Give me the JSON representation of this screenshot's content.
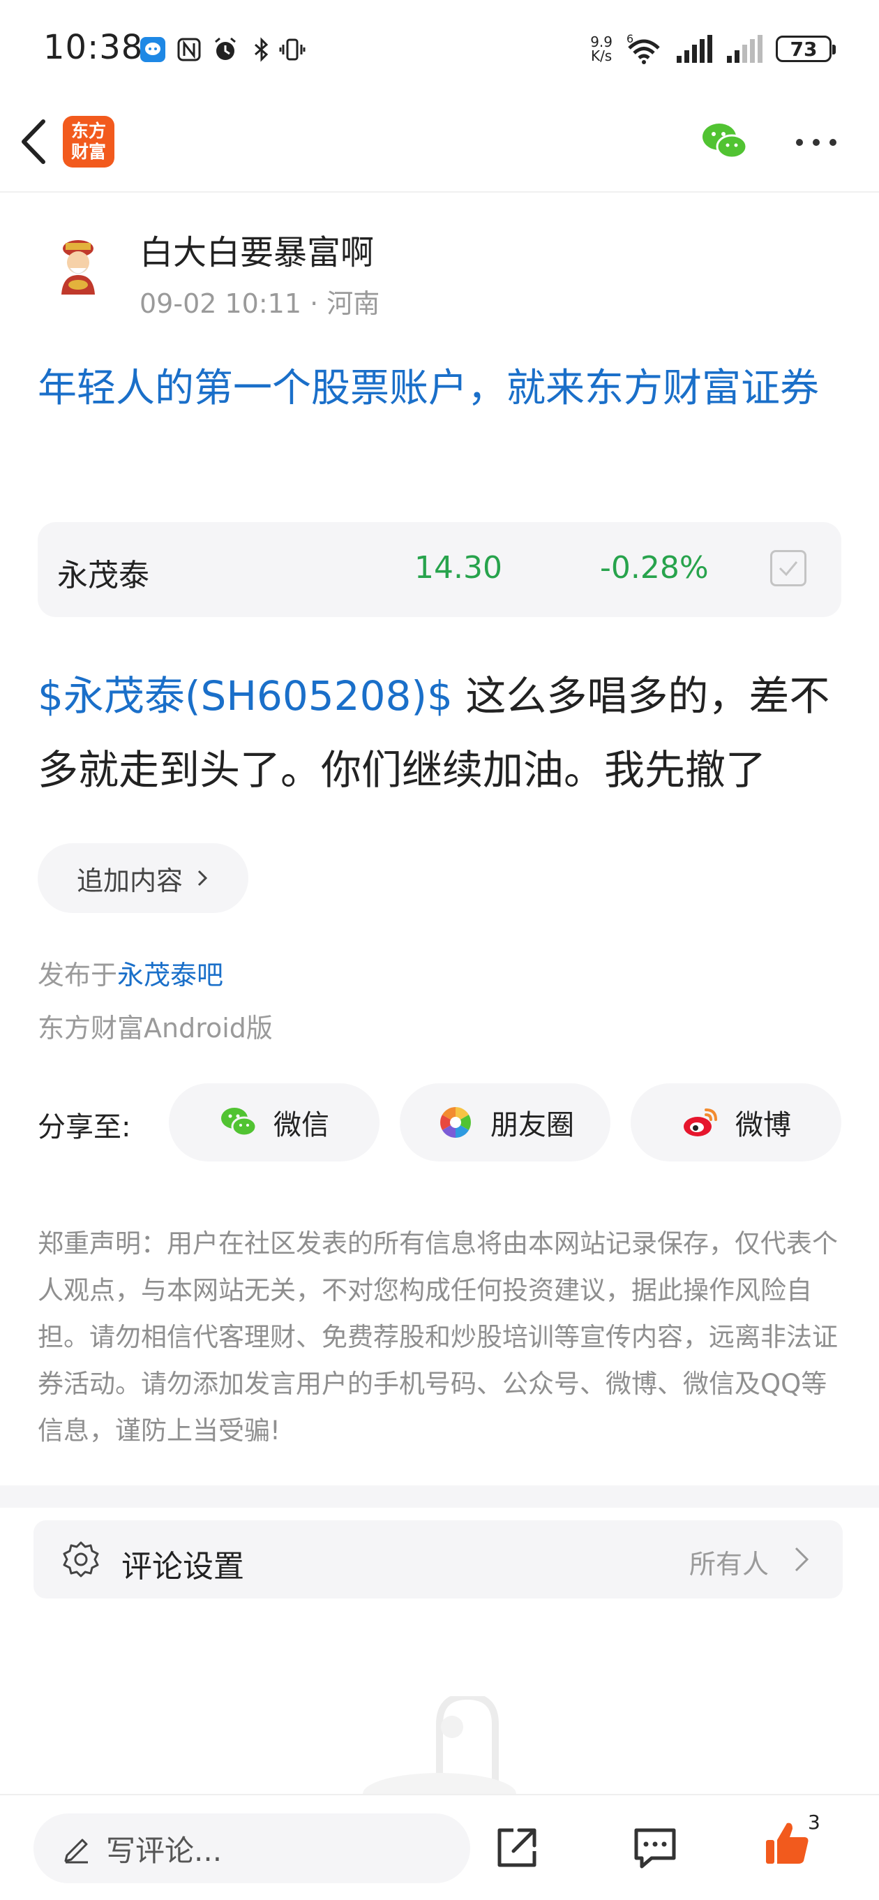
{
  "status_bar": {
    "time": "10:38",
    "net_speed_value": "9.9",
    "net_speed_unit": "K/s",
    "wifi_gen": "6",
    "battery": "73"
  },
  "nav": {
    "logo_line1": "东方",
    "logo_line2": "财富"
  },
  "author": {
    "name": "白大白要暴富啊",
    "meta": "09-02 10:11 · 河南"
  },
  "post": {
    "title": "年轻人的第一个股票账户，就来东方财富证券",
    "stock_tag": "$永茂泰(SH605208)$",
    "body": " 这么多唱多的，差不多就走到头了。你们继续加油。我先撤了"
  },
  "stock_card": {
    "name": "永茂泰",
    "price": "14.30",
    "change": "-0.28%",
    "color_down": "#27a34c"
  },
  "append_button": {
    "label": "追加内容"
  },
  "published": {
    "prefix": "发布于",
    "bar": "永茂泰吧",
    "client": "东方财富Android版"
  },
  "share": {
    "label": "分享至:",
    "wechat": "微信",
    "moments": "朋友圈",
    "weibo": "微博"
  },
  "disclaimer": "郑重声明：用户在社区发表的所有信息将由本网站记录保存，仅代表个人观点，与本网站无关，不对您构成任何投资建议，据此操作风险自担。请勿相信代客理财、免费荐股和炒股培训等宣传内容，远离非法证券活动。请勿添加发言用户的手机号码、公众号、微博、微信及QQ等信息，谨防上当受骗!",
  "comment_settings": {
    "label": "评论设置",
    "value": "所有人"
  },
  "bottom_bar": {
    "placeholder": "写评论...",
    "like_count": "3"
  },
  "colors": {
    "link_blue": "#1a6fc9",
    "brand_orange": "#f25a1d",
    "wechat_green": "#51c332"
  }
}
